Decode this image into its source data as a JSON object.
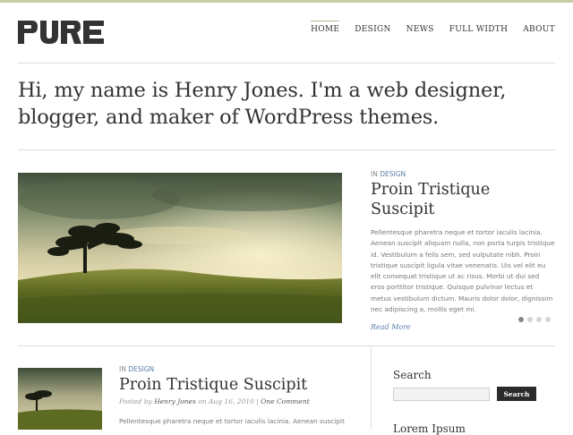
{
  "brand": {
    "logo_text": "PURE",
    "accent": "#c6cfa3",
    "link_color": "#5b7fa8"
  },
  "nav": [
    {
      "label": "HOME",
      "active": true
    },
    {
      "label": "DESIGN"
    },
    {
      "label": "NEWS"
    },
    {
      "label": "FULL WIDTH"
    },
    {
      "label": "ABOUT"
    }
  ],
  "intro": "Hi, my name is Henry Jones. I'm a web designer, blogger, and maker of WordPress themes.",
  "featured": {
    "category_prefix": "IN",
    "category": "DESIGN",
    "title": "Proin Tristique Suscipit",
    "excerpt": "Pellentesque pharetra neque et tortor iaculis lacinia. Aenean suscipit aliquam nulla, non porta turpis tristique id. Vestibulum a felis sem, sed vulputate nibh. Proin tristique suscipit ligula vitae venenatis. Uis vel elit eu elit consequat tristique ut ac risus. Morbi ut dui sed eros porttitor tristique. Quisque pulvinar lectus et metus vestibulum dictum. Mauris dolor dolor, dignissim nec adipiscing a, mollis eget mi.",
    "read_more": "Read More",
    "image": "landscape with tree on grassy hill",
    "slides": 4,
    "active_slide": 1
  },
  "post": {
    "category_prefix": "IN",
    "category": "DESIGN",
    "title": "Proin Tristique Suscipit",
    "posted_by": "Posted by",
    "author": "Henry Jones",
    "on": "on",
    "date": "Aug 16, 2010",
    "separator": "|",
    "comment_link": "One Comment",
    "excerpt": "Pellentesque pharetra neque et tortor iaculis lacinia. Aenean suscipit"
  },
  "sidebar": {
    "search_title": "Search",
    "search_value": "",
    "search_button": "Search",
    "next_title": "Lorem Ipsum"
  }
}
